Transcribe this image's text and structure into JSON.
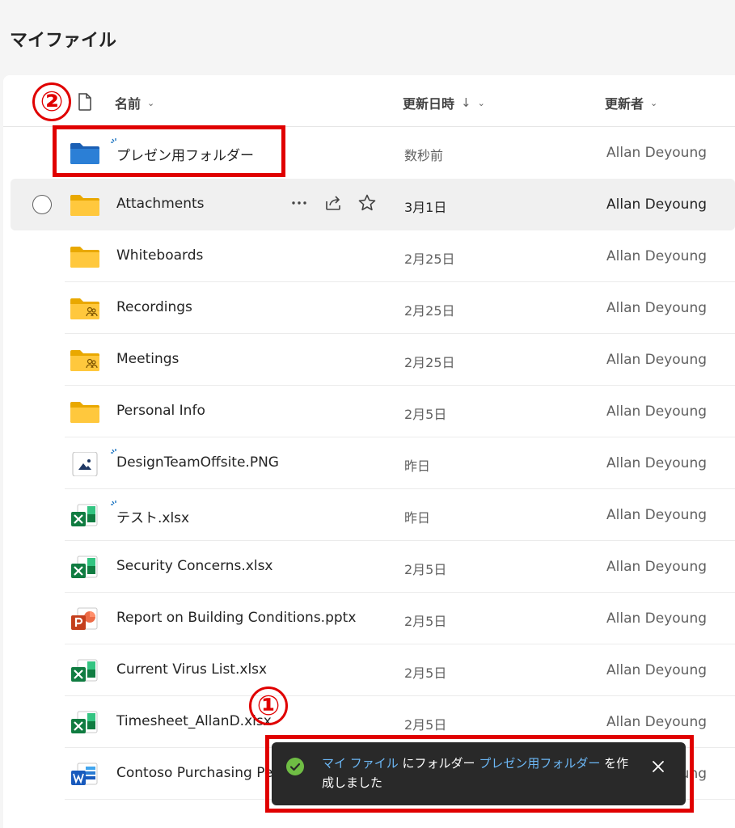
{
  "page": {
    "title": "マイファイル"
  },
  "header": {
    "name_col": "名前",
    "modified_col": "更新日時",
    "modified_sort_arrow": "↓",
    "modified_by_col": "更新者",
    "chevron": "⌄"
  },
  "rows": [
    {
      "name": "プレゼン用フォルダー",
      "date": "数秒前",
      "author": "Allan Deyoung",
      "icon": "folder-blue-icon"
    },
    {
      "name": "Attachments",
      "date": "3月1日",
      "author": "Allan Deyoung",
      "icon": "folder-icon"
    },
    {
      "name": "Whiteboards",
      "date": "2月25日",
      "author": "Allan Deyoung",
      "icon": "folder-icon"
    },
    {
      "name": "Recordings",
      "date": "2月25日",
      "author": "Allan Deyoung",
      "icon": "shared-folder-icon"
    },
    {
      "name": "Meetings",
      "date": "2月25日",
      "author": "Allan Deyoung",
      "icon": "shared-folder-icon"
    },
    {
      "name": "Personal Info",
      "date": "2月5日",
      "author": "Allan Deyoung",
      "icon": "folder-icon"
    },
    {
      "name": "DesignTeamOffsite.PNG",
      "date": "昨日",
      "author": "Allan Deyoung",
      "icon": "image-file-icon"
    },
    {
      "name": "テスト.xlsx",
      "date": "昨日",
      "author": "Allan Deyoung",
      "icon": "excel-icon"
    },
    {
      "name": "Security Concerns.xlsx",
      "date": "2月5日",
      "author": "Allan Deyoung",
      "icon": "excel-icon"
    },
    {
      "name": "Report on Building Conditions.pptx",
      "date": "2月5日",
      "author": "Allan Deyoung",
      "icon": "powerpoint-icon"
    },
    {
      "name": "Current Virus List.xlsx",
      "date": "2月5日",
      "author": "Allan Deyoung",
      "icon": "excel-icon"
    },
    {
      "name": "Timesheet_AllanD.xlsx",
      "date": "2月5日",
      "author": "Allan Deyoung",
      "icon": "excel-icon"
    },
    {
      "name": "Contoso Purchasing Pe",
      "date": "",
      "author": "Allan Deyoung",
      "icon": "word-icon"
    }
  ],
  "toast": {
    "link1": "マイ ファイル",
    "text1": " にフォルダー ",
    "link2": "プレゼン用フォルダー",
    "text2": " を作成しました"
  },
  "annotations": {
    "one": "①",
    "two": "②"
  },
  "colors": {
    "accent": "#0f6cbd",
    "annotation": "#e00000",
    "folder": "#ffc83d",
    "toast_bg": "#292929"
  }
}
